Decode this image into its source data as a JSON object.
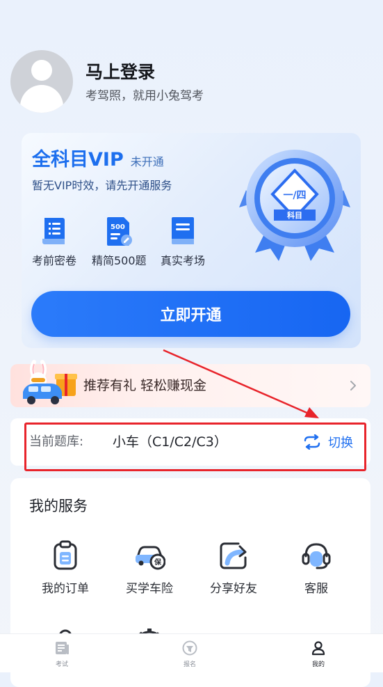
{
  "profile": {
    "login_title": "马上登录",
    "subtitle": "考驾照，就用小兔驾考"
  },
  "vip": {
    "title": "全科目VIP",
    "status": "未开通",
    "description": "暂无VIP时效，请先开通服务",
    "features": [
      {
        "icon": "document-list-icon",
        "label": "考前密卷"
      },
      {
        "icon": "500-questions-icon",
        "label": "精简500题"
      },
      {
        "icon": "exam-book-icon",
        "label": "真实考场"
      }
    ],
    "badge": {
      "top_text": "一/四",
      "ribbon_text": "科目"
    },
    "button_label": "立即开通",
    "accent_color": "#1d6fee"
  },
  "referral": {
    "text": "推荐有礼 轻松赚现金"
  },
  "question_bank": {
    "label": "当前题库:",
    "value": "小车（C1/C2/C3）",
    "switch_label": "切换"
  },
  "annotation": {
    "color": "#e8242b"
  },
  "services": {
    "title": "我的服务",
    "items": [
      {
        "icon": "clipboard-icon",
        "label": "我的订单"
      },
      {
        "icon": "car-insurance-icon",
        "label": "买学车险"
      },
      {
        "icon": "share-icon",
        "label": "分享好友"
      },
      {
        "icon": "headset-icon",
        "label": "客服"
      }
    ]
  },
  "bottom_nav": {
    "items": [
      {
        "icon": "exam-icon",
        "label": "考试",
        "active": false
      },
      {
        "icon": "signup-icon",
        "label": "报名",
        "active": false
      },
      {
        "icon": "profile-icon",
        "label": "我的",
        "active": true
      }
    ]
  }
}
